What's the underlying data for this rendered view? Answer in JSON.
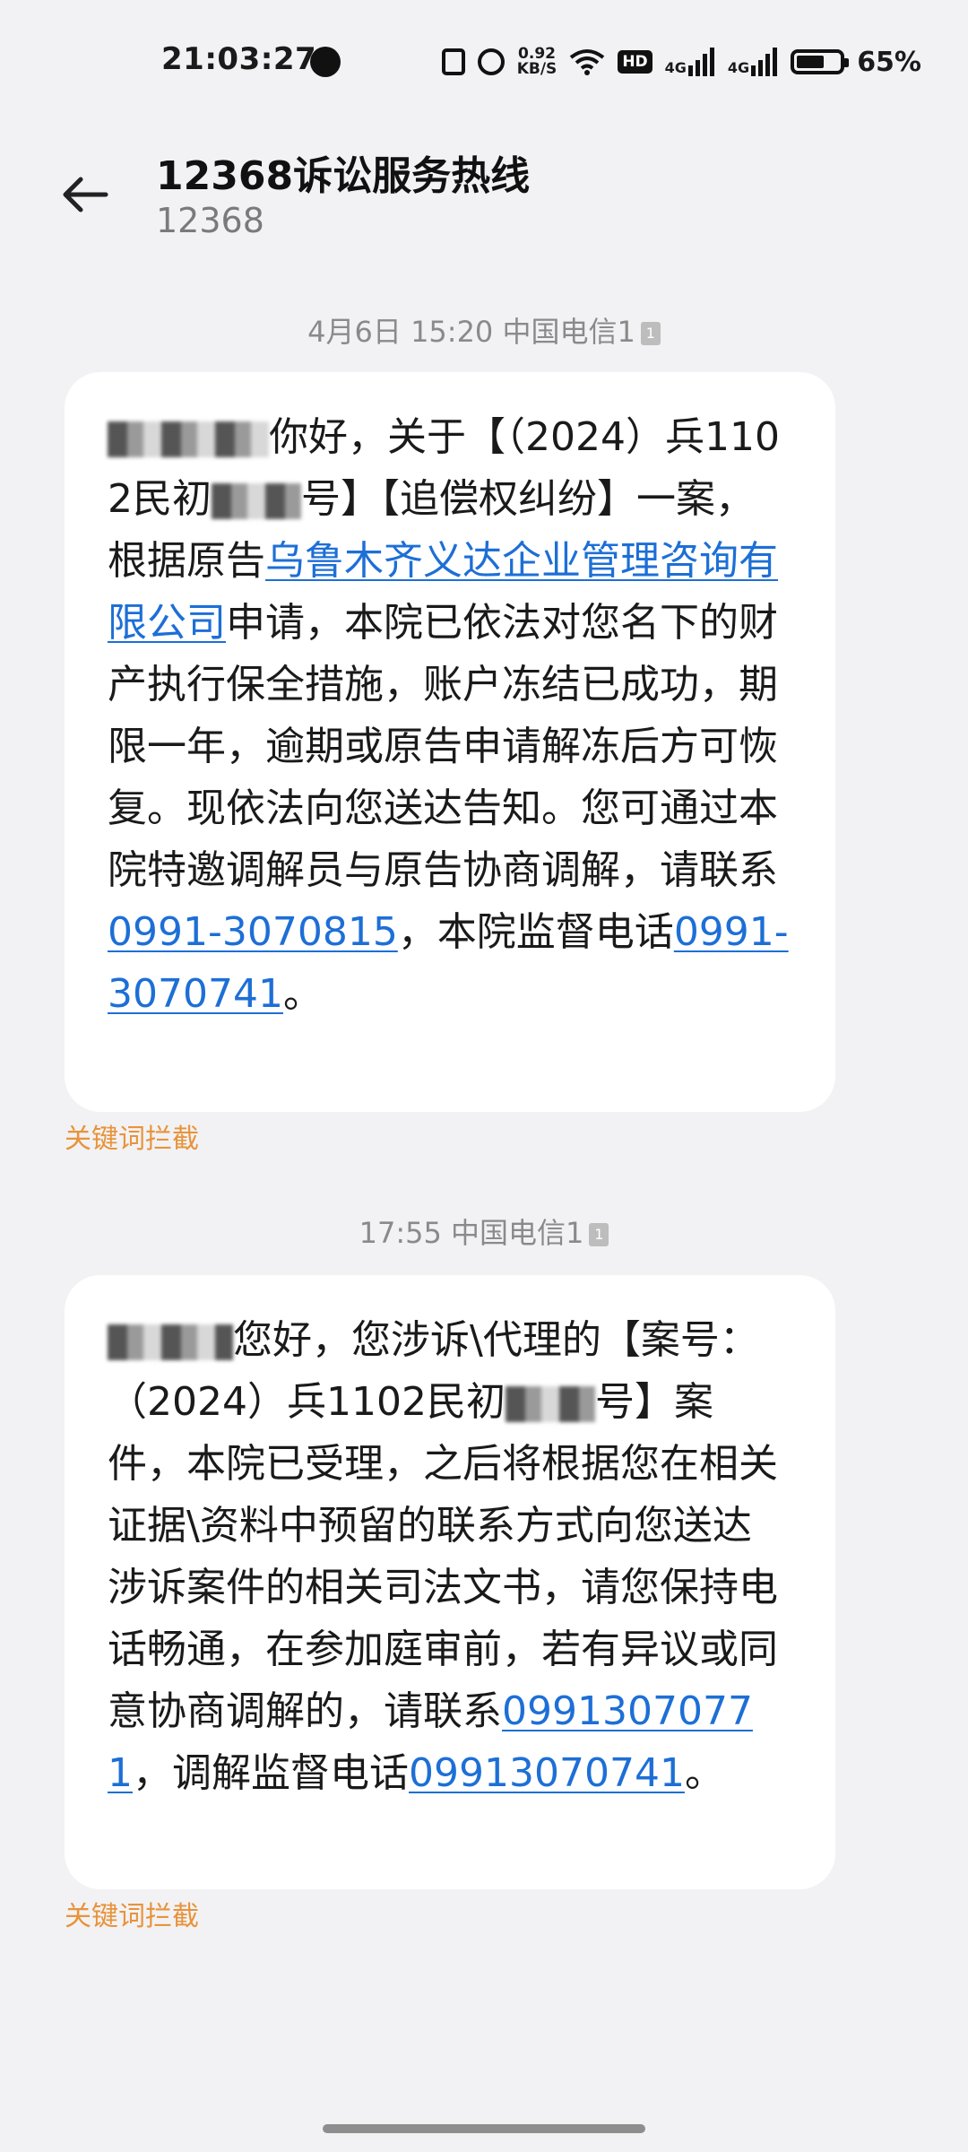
{
  "status_bar": {
    "time": "21:03:27",
    "net_speed_value": "0.92",
    "net_speed_unit": "KB/S",
    "hd_label": "HD",
    "sim1_label": "4G",
    "sim2_label": "4G",
    "battery_text": "65%",
    "battery_level": 0.65
  },
  "header": {
    "back_icon": "back-arrow-icon",
    "contact_name": "12368诉讼服务热线",
    "contact_number": "12368"
  },
  "messages": [
    {
      "meta": "4月6日 15:20 中国电信1",
      "sim_badge": "1",
      "greeting": "你好，关于【（2024）兵1102民初",
      "case_suffix": "号】【追偿权纠纷】一案，根据原告",
      "plaintiff_link": "乌鲁木齐义达企业管理咨询有限公司",
      "text_mid": "申请，本院已依法对您名下的财产执行保全措施，账户冻结已成功，期限一年，逾期或原告申请解冻后方可恢复。现依法向您送达告知。您可通过本院特邀调解员与原告协商调解，请联系",
      "phone1": "0991-3070815",
      "text_mid2": "，本院监督电话",
      "phone2": "0991-3070741",
      "text_end": "。",
      "tag": "关键词拦截"
    },
    {
      "meta": "17:55 中国电信1",
      "sim_badge": "1",
      "greeting": "您好，您涉诉\\代理的【案号：（2024）兵1102民初",
      "case_suffix": "号】案件，本院已受理，之后将根据您在相关证据\\资料中预留的联系方式向您送达涉诉案件的相关司法文书，请您保持电话畅通，在参加庭审前，若有异议或同意协商调解的，请联系",
      "phone1": "09913070771",
      "text_mid2": "，调解监督电话",
      "phone2": "09913070741",
      "text_end": "。",
      "tag": "关键词拦截"
    }
  ]
}
